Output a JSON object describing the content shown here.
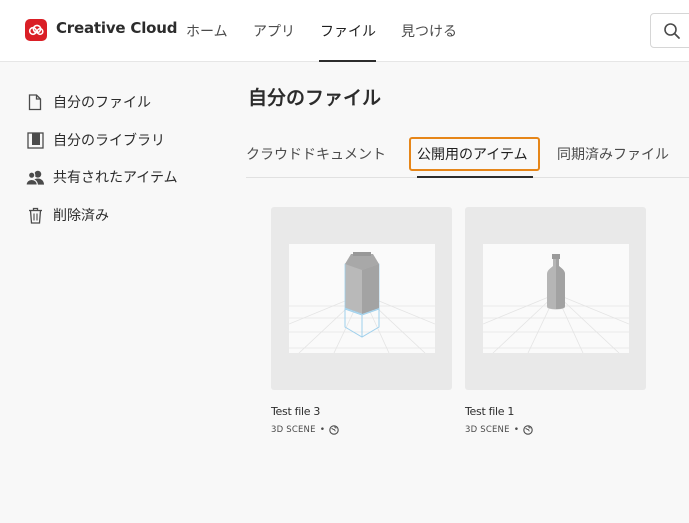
{
  "header": {
    "brand": "Creative Cloud",
    "nav": [
      {
        "label": "ホーム",
        "active": false
      },
      {
        "label": "アプリ",
        "active": false
      },
      {
        "label": "ファイル",
        "active": true
      },
      {
        "label": "見つける",
        "active": false
      }
    ],
    "search_icon": "search-icon",
    "logo_icon": "creative-cloud-logo",
    "accent_color": "#da1f26"
  },
  "sidebar": {
    "items": [
      {
        "label": "自分のファイル",
        "icon": "document-icon"
      },
      {
        "label": "自分のライブラリ",
        "icon": "library-icon"
      },
      {
        "label": "共有されたアイテム",
        "icon": "shared-users-icon"
      },
      {
        "label": "削除済み",
        "icon": "trash-icon"
      }
    ]
  },
  "main": {
    "title": "自分のファイル",
    "tabs": [
      {
        "label": "クラウドドキュメント",
        "active": false
      },
      {
        "label": "公開用のアイテム",
        "active": true
      },
      {
        "label": "同期済みファイル",
        "active": false
      }
    ],
    "focus_color": "#e68619",
    "files": [
      {
        "name": "Test file 3",
        "type": "3D SCENE",
        "separator": "•",
        "status_icon": "published-globe-icon",
        "thumbnail": "milk-carton-3d"
      },
      {
        "name": "Test file 1",
        "type": "3D SCENE",
        "separator": "•",
        "status_icon": "published-globe-icon",
        "thumbnail": "bottle-3d"
      }
    ]
  }
}
